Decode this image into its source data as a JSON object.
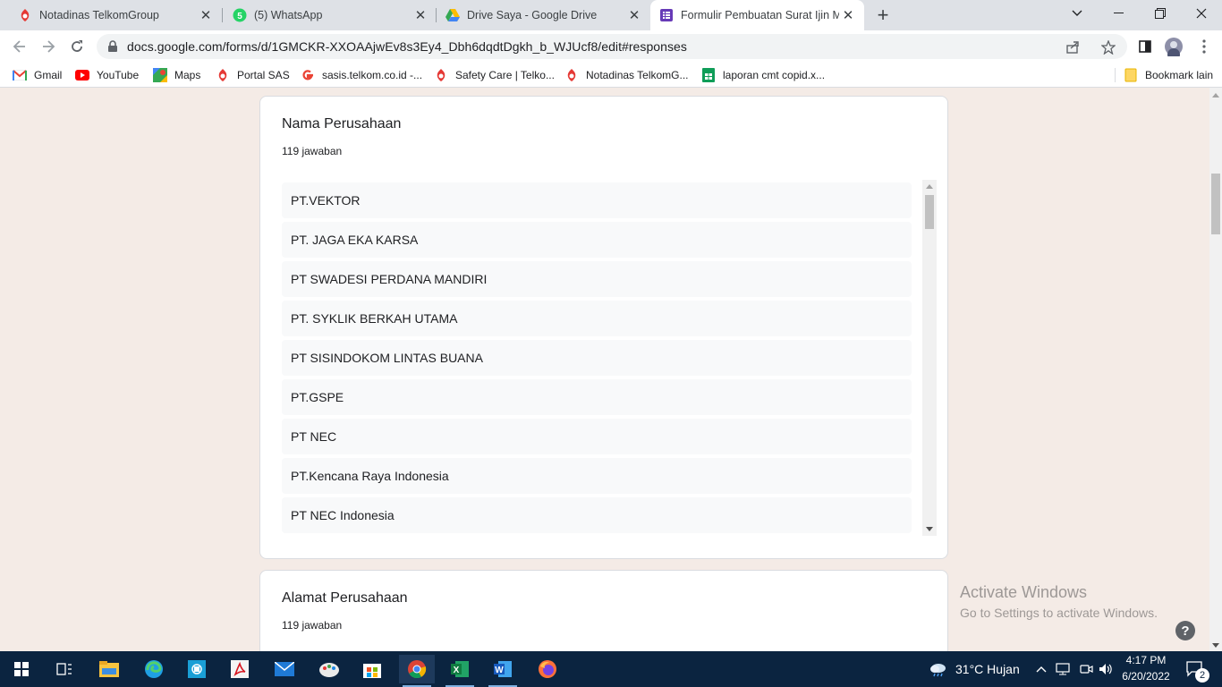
{
  "browser": {
    "tabs": [
      {
        "title": "Notadinas TelkomGroup",
        "icon": "telkom-icon",
        "active": false
      },
      {
        "title": "(5) WhatsApp",
        "icon": "whatsapp-icon",
        "badge": "5",
        "active": false
      },
      {
        "title": "Drive Saya - Google Drive",
        "icon": "google-drive-icon",
        "active": false
      },
      {
        "title": "Formulir Pembuatan Surat Ijin Ma",
        "icon": "google-forms-icon",
        "active": true
      }
    ],
    "new_tab_label": "+",
    "url": "docs.google.com/forms/d/1GMCKR-XXOAAjwEv8s3Ey4_Dbh6dqdtDgkh_b_WJUcf8/edit#responses",
    "bookmarks": [
      {
        "label": "Gmail",
        "icon": "gmail-icon"
      },
      {
        "label": "YouTube",
        "icon": "youtube-icon"
      },
      {
        "label": "Maps",
        "icon": "maps-icon"
      },
      {
        "label": "Portal SAS",
        "icon": "telkom-icon"
      },
      {
        "label": "sasis.telkom.co.id -...",
        "icon": "google-icon"
      },
      {
        "label": "Safety Care | Telko...",
        "icon": "telkom-icon"
      },
      {
        "label": "Notadinas TelkomG...",
        "icon": "telkom-icon"
      },
      {
        "label": "laporan cmt copid.x...",
        "icon": "sheets-icon"
      }
    ],
    "other_bookmarks": "Bookmark lain"
  },
  "form": {
    "question1": {
      "title": "Nama Perusahaan",
      "count": "119 jawaban",
      "responses": [
        "PT.VEKTOR",
        "PT. JAGA EKA KARSA",
        "PT SWADESI PERDANA MANDIRI",
        "PT. SYKLIK BERKAH UTAMA",
        "PT SISINDOKOM LINTAS BUANA",
        "PT.GSPE",
        "PT NEC",
        "PT.Kencana Raya Indonesia",
        "PT NEC Indonesia"
      ]
    },
    "question2": {
      "title": "Alamat Perusahaan",
      "count": "119 jawaban"
    }
  },
  "watermark": {
    "line1": "Activate Windows",
    "line2": "Go to Settings to activate Windows."
  },
  "help_label": "?",
  "taskbar": {
    "weather": "31°C  Hujan",
    "time": "4:17 PM",
    "date": "6/20/2022",
    "notifications": "2"
  },
  "colors": {
    "page_bg": "#f4ebe6",
    "forms_purple": "#673ab7",
    "taskbar_bg": "#0b2440"
  }
}
